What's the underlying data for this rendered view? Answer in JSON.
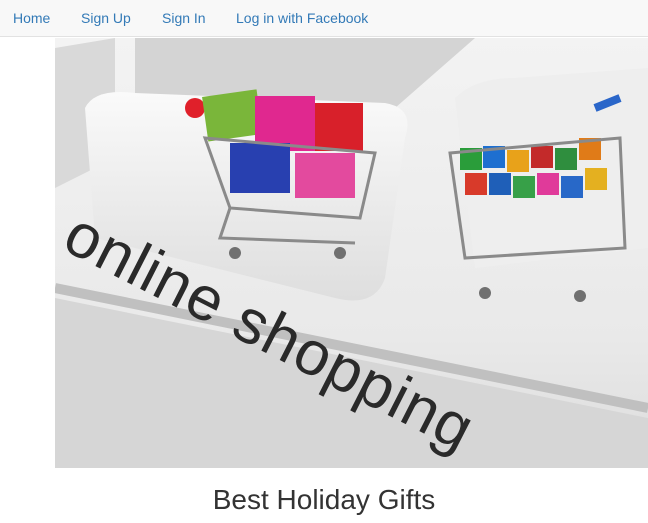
{
  "nav": {
    "home": "Home",
    "sign_up": "Sign Up",
    "sign_in": "Sign In",
    "facebook": "Log in with Facebook"
  },
  "hero": {
    "caption": "online shopping"
  },
  "main": {
    "title": "Best Holiday Gifts"
  },
  "colors": {
    "link": "#337ab7",
    "navbar_bg": "#f8f8f8",
    "title_text": "#333333"
  }
}
